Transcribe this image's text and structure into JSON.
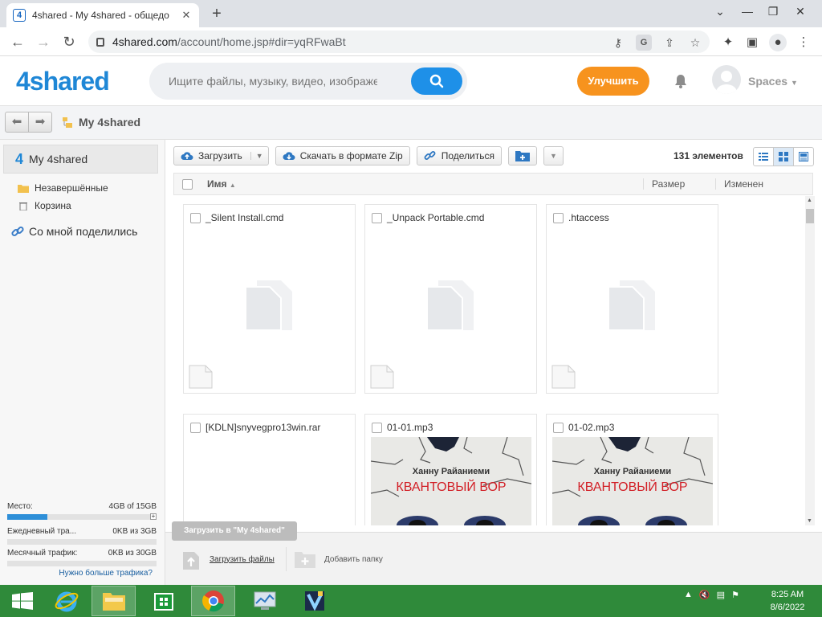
{
  "browser": {
    "tab_title": "4shared - My 4shared - общедо",
    "url_host": "4shared.com",
    "url_path": "/account/home.jsp#dir=yqRFwaBt"
  },
  "site": {
    "logo": "4shared",
    "search_placeholder": "Ищите файлы, музыку, видео, изображения",
    "upgrade_label": "Улучшить",
    "user_label": "Spaces"
  },
  "breadcrumb": {
    "current": "My 4shared"
  },
  "sidebar": {
    "root": "My 4shared",
    "items": [
      {
        "label": "Незавершённые"
      },
      {
        "label": "Корзина"
      }
    ],
    "shared": "Со мной поделились",
    "stats": [
      {
        "label": "Место:",
        "value": "4GB of 15GB",
        "fill": 0.27
      },
      {
        "label": "Ежедневный тра...",
        "value": "0KB из 3GB",
        "fill": 0
      },
      {
        "label": "Месячный трафик:",
        "value": "0KB из 30GB",
        "fill": 0
      }
    ],
    "more_traffic": "Нужно больше трафика?"
  },
  "toolbar": {
    "upload": "Загрузить",
    "zip": "Скачать в формате Zip",
    "share": "Поделиться",
    "count": "131 элементов"
  },
  "columns": {
    "name": "Имя",
    "size": "Размер",
    "modified": "Изменен"
  },
  "files": [
    {
      "name": "_Silent Install.cmd"
    },
    {
      "name": "_Unpack Portable.cmd"
    },
    {
      "name": ".htaccess"
    },
    {
      "name": "[KDLN]snyvegpro13win.rar"
    },
    {
      "name": "01-01.mp3",
      "cover_author": "Ханну Райаниеми",
      "cover_title": "КВАНТОВЫЙ ВОР"
    },
    {
      "name": "01-02.mp3",
      "cover_author": "Ханну Райаниеми",
      "cover_title": "КВАНТОВЫЙ ВОР"
    }
  ],
  "bottom": {
    "tooltip": "Загрузить в \"My 4shared\"",
    "upload_files": "Загрузить файлы",
    "add_folder": "Добавить папку"
  },
  "taskbar": {
    "time": "8:25 AM",
    "date": "8/6/2022"
  },
  "colors": {
    "brand": "#1f87d6",
    "accent": "#f7931e",
    "taskbar": "#2f8a3a"
  }
}
